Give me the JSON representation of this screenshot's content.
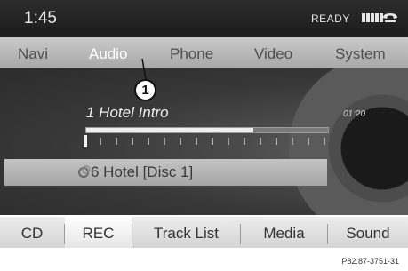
{
  "status": {
    "time": "1:45",
    "ready": "READY",
    "signal_icon": "signal-bars-icon",
    "phone_icon": "phone-handset-icon"
  },
  "tabs": [
    {
      "label": "Navi"
    },
    {
      "label": "Audio",
      "active": true
    },
    {
      "label": "Phone"
    },
    {
      "label": "Video"
    },
    {
      "label": "System"
    }
  ],
  "track": {
    "title": "1 Hotel Intro",
    "elapsed": "01:20",
    "progress_fraction": 0.69,
    "disc_label": "6 Hotel [Disc 1]",
    "disc_icon": "cd-disc-icon"
  },
  "bottom_menu": [
    {
      "label": "CD"
    },
    {
      "label": "REC",
      "active": true
    },
    {
      "label": "Track List"
    },
    {
      "label": "Media"
    },
    {
      "label": "Sound"
    }
  ],
  "callout": {
    "number": "1"
  },
  "caption": "P82.87-3751-31",
  "colors": {
    "screen_bg": "#2f2f2f",
    "tab_bar": "#b8b8b8",
    "active_text": "#ffffff",
    "bottom_bar": "#e0e0e0"
  }
}
